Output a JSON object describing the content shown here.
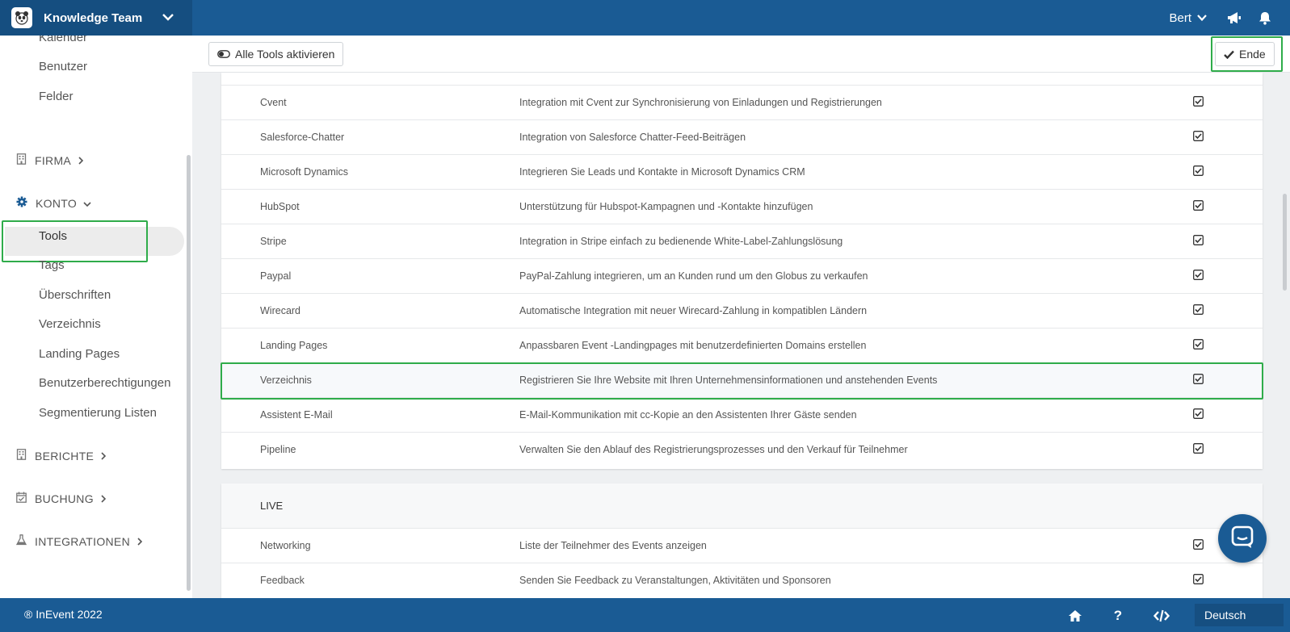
{
  "header": {
    "team_name": "Knowledge Team",
    "user_name": "Bert"
  },
  "sidebar": {
    "items_top": [
      {
        "label": "Kalender"
      },
      {
        "label": "Benutzer"
      },
      {
        "label": "Felder"
      }
    ],
    "sections": [
      {
        "label": "FIRMA",
        "icon": "building-icon"
      },
      {
        "label": "KONTO",
        "icon": "gear-icon"
      },
      {
        "label": "BERICHTE",
        "icon": "building-icon"
      },
      {
        "label": "BUCHUNG",
        "icon": "calendar-check-icon"
      },
      {
        "label": "INTEGRATIONEN",
        "icon": "flask-icon"
      }
    ],
    "konto_items": [
      {
        "label": "Tools",
        "active": true
      },
      {
        "label": "Tags"
      },
      {
        "label": "Überschriften"
      },
      {
        "label": "Verzeichnis"
      },
      {
        "label": "Landing Pages"
      },
      {
        "label": "Benutzerberechtigungen"
      },
      {
        "label": "Segmentierung Listen"
      }
    ]
  },
  "toolbar": {
    "activate_all_label": "Alle Tools aktivieren",
    "end_label": "Ende"
  },
  "tools": [
    {
      "name": "Cvent",
      "desc": "Integration mit Cvent zur Synchronisierung von Einladungen und Registrierungen",
      "enabled": true
    },
    {
      "name": "Salesforce-Chatter",
      "desc": "Integration von Salesforce Chatter-Feed-Beiträgen",
      "enabled": true
    },
    {
      "name": "Microsoft Dynamics",
      "desc": "Integrieren Sie Leads und Kontakte in Microsoft Dynamics CRM",
      "enabled": true
    },
    {
      "name": "HubSpot",
      "desc": "Unterstützung für Hubspot-Kampagnen und -Kontakte hinzufügen",
      "enabled": true
    },
    {
      "name": "Stripe",
      "desc": "Integration in Stripe einfach zu bedienende White-Label-Zahlungslösung",
      "enabled": true
    },
    {
      "name": "Paypal",
      "desc": "PayPal-Zahlung integrieren, um an Kunden rund um den Globus zu verkaufen",
      "enabled": true
    },
    {
      "name": "Wirecard",
      "desc": "Automatische Integration mit neuer Wirecard-Zahlung in kompatiblen Ländern",
      "enabled": true
    },
    {
      "name": "Landing Pages",
      "desc": "Anpassbaren Event -Landingpages mit benutzerdefinierten Domains erstellen",
      "enabled": true
    },
    {
      "name": "Verzeichnis",
      "desc": "Registrieren Sie Ihre Website mit Ihren Unternehmensinformationen und anstehenden Events",
      "enabled": true
    },
    {
      "name": "Assistent E-Mail",
      "desc": "E-Mail-Kommunikation mit cc-Kopie an den Assistenten Ihrer Gäste senden",
      "enabled": true
    },
    {
      "name": "Pipeline",
      "desc": "Verwalten Sie den Ablauf des Registrierungsprozesses und den Verkauf für Teilnehmer",
      "enabled": true
    }
  ],
  "live_section": {
    "title": "LIVE",
    "tools": [
      {
        "name": "Networking",
        "desc": "Liste der Teilnehmer des Events anzeigen",
        "enabled": true
      },
      {
        "name": "Feedback",
        "desc": "Senden Sie Feedback zu Veranstaltungen, Aktivitäten und Sponsoren",
        "enabled": true
      }
    ]
  },
  "footer": {
    "copyright": "® InEvent 2022",
    "help_label": "?",
    "language": "Deutsch"
  },
  "colors": {
    "primary": "#1a5b94",
    "highlight": "#2fac4a"
  }
}
